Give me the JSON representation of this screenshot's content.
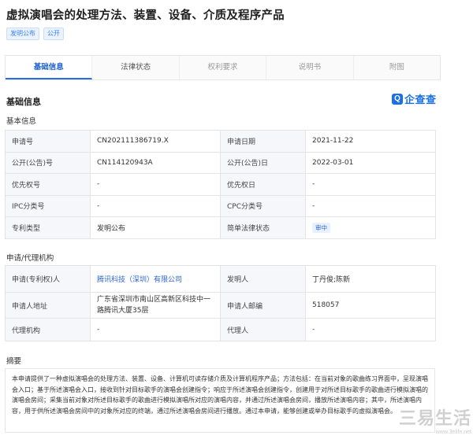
{
  "header": {
    "title": "虚拟演唱会的处理方法、装置、设备、介质及程序产品",
    "tags": [
      "发明公布",
      "公开"
    ]
  },
  "tabs": [
    {
      "label": "基础信息",
      "active": true
    },
    {
      "label": "法律状态",
      "active": false
    },
    {
      "label": "权利要求",
      "active": false
    },
    {
      "label": "说明书",
      "active": false
    },
    {
      "label": "附图",
      "active": false
    }
  ],
  "basic_info": {
    "heading": "基础信息",
    "brand": {
      "mark": "Q",
      "text": "企查查"
    },
    "subheading": "基本信息",
    "rows": [
      {
        "k1": "申请号",
        "v1": "CN202111386719.X",
        "k2": "申请日期",
        "v2": "2021-11-22"
      },
      {
        "k1": "公开(公告)号",
        "v1": "CN114120943A",
        "k2": "公开(公告)日",
        "v2": "2022-03-01"
      },
      {
        "k1": "优先权号",
        "v1": "-",
        "k2": "优先权日",
        "v2": "-"
      },
      {
        "k1": "IPC分类号",
        "v1": "-",
        "k2": "CPC分类号",
        "v2": "-"
      },
      {
        "k1": "专利类型",
        "v1": "发明公布",
        "k2": "简单法律状态",
        "v2": "审中"
      }
    ]
  },
  "applicant": {
    "subheading": "申请/代理机构",
    "rows": [
      {
        "k1": "申请(专利权)人",
        "v1": "腾讯科技（深圳）有限公司",
        "k2": "发明人",
        "v2": "丁丹俊;陈新"
      },
      {
        "k1": "申请人地址",
        "v1": "广东省深圳市南山区高新区科技中一路腾讯大厦35层",
        "k2": "申请人邮编",
        "v2": "518057"
      },
      {
        "k1": "代理机构",
        "v1": "-",
        "k2": "代理人",
        "v2": "-"
      }
    ]
  },
  "abstract": {
    "heading": "摘要",
    "text": "本申请提供了一种虚拟演唱会的处理方法、装置、设备、计算机可读存储介质及计算机程序产品；方法包括：在当前对象的歌曲练习界面中，呈现演唱会入口；基于所述演唱会入口，接收到针对目标歌手的演唱会创建指令；响应于所述演唱会创建指令，创建用于对所述目标歌手的歌曲进行模拟演唱的演唱会房间；采集当前对象对所述目标歌手的歌曲进行模拟演唱所对应的演唱内容，并通过所述演唱会房间，播放所述演唱内容；其中，所述演唱内容，用于供所述演唱会房间中的对象所对应的终端，通过所述演唱会房间进行播放。通过本申请，能够创建或举办目标歌手的虚拟演唱会。"
  },
  "watermark": {
    "main": "三易生活",
    "url": "www.3elife.net"
  }
}
